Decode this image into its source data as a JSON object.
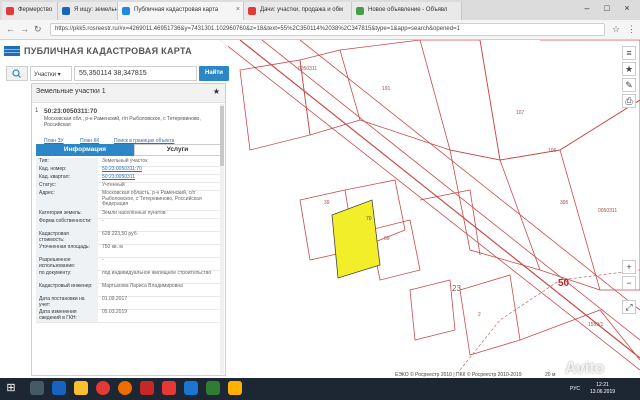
{
  "browser": {
    "tabs": [
      {
        "label": "Фермерство",
        "color": "#e53935"
      },
      {
        "label": "Я ищу: земельн",
        "color": "#1565c0"
      },
      {
        "label": "Публичная кадастровая карта",
        "color": "#1e88e5",
        "active": true
      },
      {
        "label": "Дачи: участки, продажа и обм",
        "color": "#e53935"
      },
      {
        "label": "Новое объявление - Объявл",
        "color": "#43a047"
      }
    ],
    "url": "https://pkk5.rosreestr.ru/#x=4269011.46951736&y=7431301.102960760&z=18&text=55%2C350114%2038%2C347815&type=1&app=search&opened=1"
  },
  "header": {
    "title": "ПУБЛИЧНАЯ КАДАСТРОВАЯ КАРТА"
  },
  "search": {
    "type_label": "Участки ▾",
    "query": "55,350114 38,347815",
    "button": "Найти"
  },
  "panel": {
    "title": "Земельные участки 1",
    "card_index": "1",
    "cadastral_number": "50:23:0050311:70",
    "address": "Московская обл., р-н Раменский, г/п Рыболовское, с Тетеревиново, Российская",
    "links": [
      "План ЗУ",
      "План КК",
      "Поиск в границах объекта"
    ],
    "tab_info": "Информация",
    "tab_services": "Услуги",
    "rows": [
      {
        "label": "Тип:",
        "value": "Земельный участок"
      },
      {
        "label": "Кад. номер:",
        "value": "50:23:0050311:70",
        "link": true
      },
      {
        "label": "Кад. квартал:",
        "value": "50:23:0050311",
        "link": true
      },
      {
        "label": "Статус:",
        "value": "Учтенный"
      },
      {
        "label": "Адрес:",
        "value": "Московская область, р-н Раменский, с/п Рыболовское, с Тетеревиново, Российская Федерация"
      },
      {
        "label": "Категория земель:",
        "value": "Земли населённых пунктов"
      },
      {
        "label": "Форма собственности:",
        "value": "-"
      },
      {
        "label": "Кадастровая стоимость:",
        "value": "628 223,50 руб."
      },
      {
        "label": "Уточненная площадь:",
        "value": "750 кв. м"
      },
      {
        "label": "Разрешенное использование:",
        "value": "-"
      },
      {
        "label": "по документу:",
        "value": "под индивидуальное жилищное строительство"
      },
      {
        "label": "Кадастровый инженер:",
        "value": "Мартынова Лариса Владимировна"
      },
      {
        "label": "Дата постановки на учет:",
        "value": "01.09.2017"
      },
      {
        "label": "Дата изменения сведений в ГКН:",
        "value": "05.03.2019"
      }
    ]
  },
  "map": {
    "labels": [
      "0050311",
      "191",
      "107",
      "106",
      "395",
      "0050311",
      "39",
      "70",
      "69",
      "23",
      "50",
      "2",
      "1559/1"
    ],
    "copyright": "ЕЭКО © Росреестр 2010 | ПКК © Росреестр 2010-2019",
    "scale": "20 м"
  },
  "taskbar": {
    "lang": "РУС",
    "time": "12:21",
    "date": "13.06.2019"
  },
  "watermark": "Avito"
}
